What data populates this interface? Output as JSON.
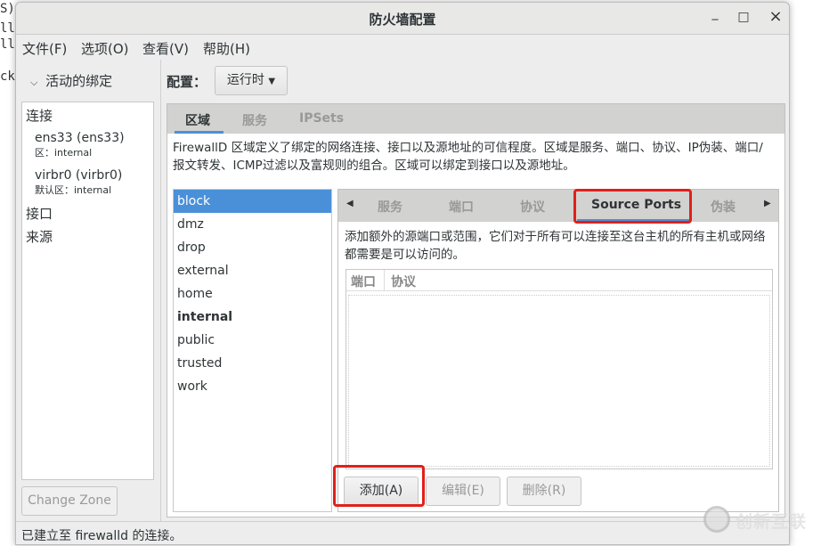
{
  "terminal_fragments": [
    "S)",
    "ll-",
    "ll-",
    "ck-"
  ],
  "window": {
    "title": "防火墙配置",
    "minimize": "_",
    "maximize": "□",
    "close": "×"
  },
  "menu": [
    "文件(F)",
    "选项(O)",
    "查看(V)",
    "帮助(H)"
  ],
  "left": {
    "header": "活动的绑定",
    "sections": {
      "connections": "连接",
      "interfaces": "接口",
      "sources": "来源"
    },
    "connections": [
      {
        "name": "ens33 (ens33)",
        "zone": "区：internal"
      },
      {
        "name": "virbr0 (virbr0)",
        "zone": "默认区：internal"
      }
    ],
    "change_zone": "Change Zone"
  },
  "config": {
    "label": "配置：",
    "value": "运行时"
  },
  "top_tabs": [
    {
      "label": "区域",
      "active": true
    },
    {
      "label": "服务",
      "active": false
    },
    {
      "label": "IPSets",
      "active": false
    }
  ],
  "zone_description": "FirewallD 区域定义了绑定的网络连接、接口以及源地址的可信程度。区域是服务、端口、协议、IP伪装、端口/报文转发、ICMP过滤以及富规则的组合。区域可以绑定到接口以及源地址。",
  "zones": [
    {
      "name": "block",
      "selected": true
    },
    {
      "name": "dmz"
    },
    {
      "name": "drop"
    },
    {
      "name": "external"
    },
    {
      "name": "home"
    },
    {
      "name": "internal",
      "bold": true
    },
    {
      "name": "public"
    },
    {
      "name": "trusted"
    },
    {
      "name": "work"
    }
  ],
  "inner_tabs": [
    {
      "label": "服务"
    },
    {
      "label": "端口"
    },
    {
      "label": "协议"
    },
    {
      "label": "Source Ports",
      "active": true
    },
    {
      "label": "伪装"
    }
  ],
  "source_ports": {
    "description": "添加额外的源端口或范围，它们对于所有可以连接至这台主机的所有主机或网络都需要是可以访问的。",
    "columns": [
      "端口",
      "协议"
    ],
    "buttons": {
      "add": "添加(A)",
      "edit": "编辑(E)",
      "remove": "删除(R)"
    }
  },
  "status": "已建立至 firewalld 的连接。",
  "watermark": "创新互联",
  "colors": {
    "selection": "#4a90d9",
    "highlight": "#e0201a"
  }
}
